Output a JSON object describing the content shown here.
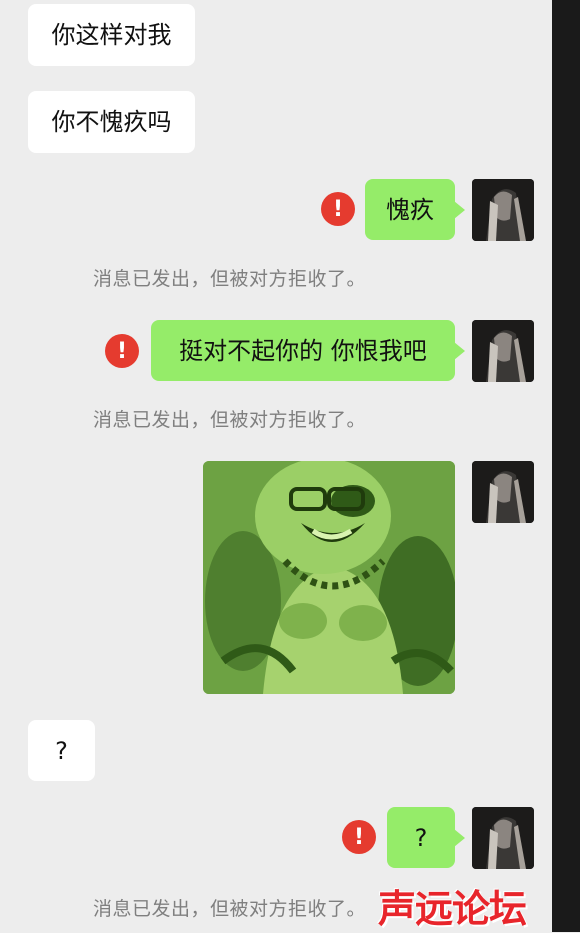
{
  "chat": {
    "messages": [
      {
        "type": "incoming",
        "text": "你这样对我"
      },
      {
        "type": "incoming",
        "text": "你不愧疚吗"
      },
      {
        "type": "outgoing",
        "text": "愧疚",
        "failed": true
      },
      {
        "type": "outgoing",
        "text": "挺对不起你的 你恨我吧",
        "failed": true
      },
      {
        "type": "outgoing",
        "image": "green-tinted-laughing-buddha-meme",
        "failed": false
      },
      {
        "type": "incoming",
        "text": "?"
      },
      {
        "type": "outgoing",
        "text": "?",
        "failed": true
      }
    ],
    "rejected_notice": "消息已发出，但被对方拒收了。",
    "error_symbol": "!"
  },
  "watermark": {
    "text": "声远论坛",
    "color": "#e8252b"
  },
  "colors": {
    "outgoing_bubble": "#95ec69",
    "incoming_bubble": "#ffffff",
    "error": "#e53b2f",
    "background": "#ededed"
  },
  "icons": {
    "error": "exclamation-circle-icon",
    "avatar": "user-avatar"
  }
}
